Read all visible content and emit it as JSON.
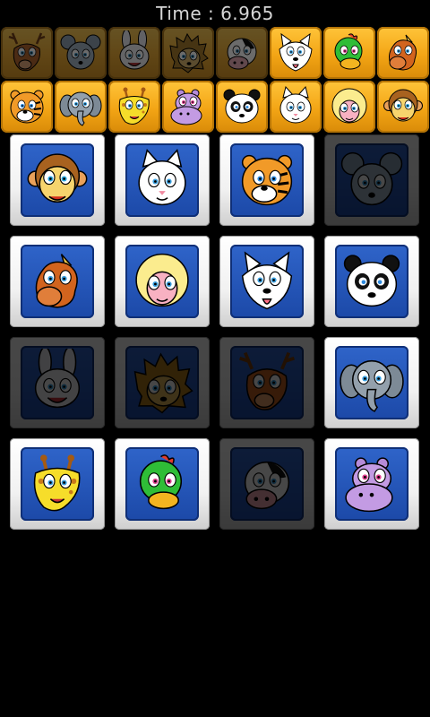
{
  "header": {
    "timer_text": "Time : 6.965"
  },
  "palette": {
    "strip_tile": "#f3a515",
    "card_frame": "#f1f1f1",
    "card_face": "#1c49a8",
    "background": "#000000"
  },
  "status_strip": {
    "row1": [
      {
        "animal": "deer",
        "found": false
      },
      {
        "animal": "mouse",
        "found": false
      },
      {
        "animal": "rabbit",
        "found": false
      },
      {
        "animal": "hedgehog",
        "found": false
      },
      {
        "animal": "cow",
        "found": false
      },
      {
        "animal": "wolf",
        "found": true
      },
      {
        "animal": "duck",
        "found": true
      },
      {
        "animal": "horse",
        "found": true
      }
    ],
    "row2": [
      {
        "animal": "tiger",
        "found": true
      },
      {
        "animal": "elephant",
        "found": true
      },
      {
        "animal": "giraffe",
        "found": true
      },
      {
        "animal": "hippo",
        "found": true
      },
      {
        "animal": "panda",
        "found": true
      },
      {
        "animal": "cat",
        "found": true
      },
      {
        "animal": "sheep",
        "found": true
      },
      {
        "animal": "monkey",
        "found": true
      }
    ]
  },
  "board": {
    "rows": [
      [
        {
          "animal": "monkey",
          "state": "open"
        },
        {
          "animal": "cat",
          "state": "open"
        },
        {
          "animal": "tiger",
          "state": "open"
        },
        {
          "animal": "mouse",
          "state": "matched"
        }
      ],
      [
        {
          "animal": "horse",
          "state": "open"
        },
        {
          "animal": "sheep",
          "state": "open"
        },
        {
          "animal": "wolf",
          "state": "open"
        },
        {
          "animal": "panda",
          "state": "open"
        }
      ],
      [
        {
          "animal": "rabbit",
          "state": "matched"
        },
        {
          "animal": "hedgehog",
          "state": "matched"
        },
        {
          "animal": "deer",
          "state": "matched"
        },
        {
          "animal": "elephant",
          "state": "open"
        }
      ],
      [
        {
          "animal": "giraffe",
          "state": "open"
        },
        {
          "animal": "duck",
          "state": "open"
        },
        {
          "animal": "cow",
          "state": "matched"
        },
        {
          "animal": "hippo",
          "state": "open"
        }
      ]
    ]
  }
}
